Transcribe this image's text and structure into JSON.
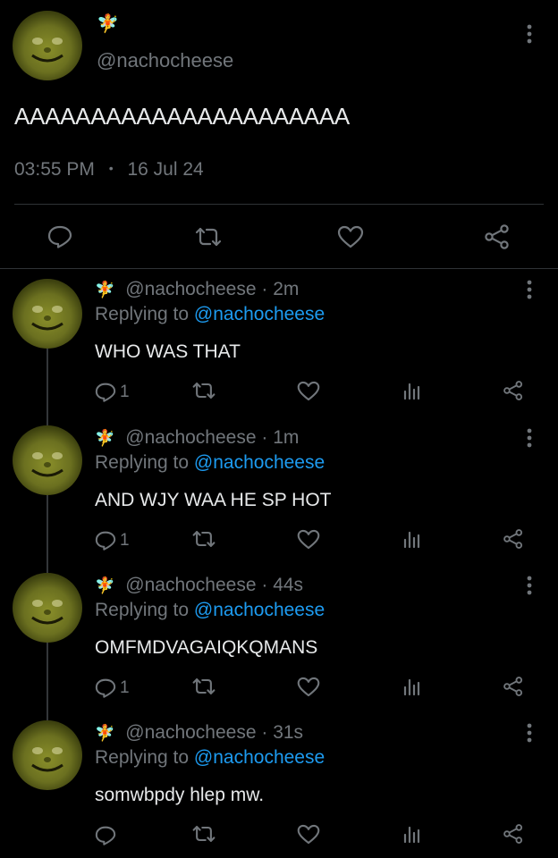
{
  "main_tweet": {
    "badge": "🧚",
    "handle": "@nachocheese",
    "text": "AAAAAAAAAAAAAAAAAAAAAA",
    "time": "03:55 PM",
    "separator": "•",
    "date": "16 Jul 24"
  },
  "replies": [
    {
      "badge": "🧚",
      "handle": "@nachocheese",
      "age": "· 2m",
      "replying_prefix": "Replying to",
      "replying_handle": "@nachocheese",
      "text": "WHO WAS THAT",
      "reply_count": "1"
    },
    {
      "badge": "🧚",
      "handle": "@nachocheese",
      "age": "· 1m",
      "replying_prefix": "Replying to",
      "replying_handle": "@nachocheese",
      "text": "AND WJY WAA HE SP HOT",
      "reply_count": "1"
    },
    {
      "badge": "🧚",
      "handle": "@nachocheese",
      "age": "· 44s",
      "replying_prefix": "Replying to",
      "replying_handle": "@nachocheese",
      "text": "OMFMDVAGAIQKQMANS",
      "reply_count": "1"
    },
    {
      "badge": "🧚",
      "handle": "@nachocheese",
      "age": "· 31s",
      "replying_prefix": "Replying to",
      "replying_handle": "@nachocheese",
      "text": "somwbpdy hlep mw.",
      "reply_count": ""
    }
  ],
  "colors": {
    "background": "#000000",
    "text": "#e7e9ea",
    "secondary": "#71767b",
    "link": "#1d9bf0"
  },
  "icons": [
    "kebab-menu-icon",
    "reply-icon",
    "retweet-icon",
    "like-icon",
    "share-icon",
    "views-icon"
  ]
}
